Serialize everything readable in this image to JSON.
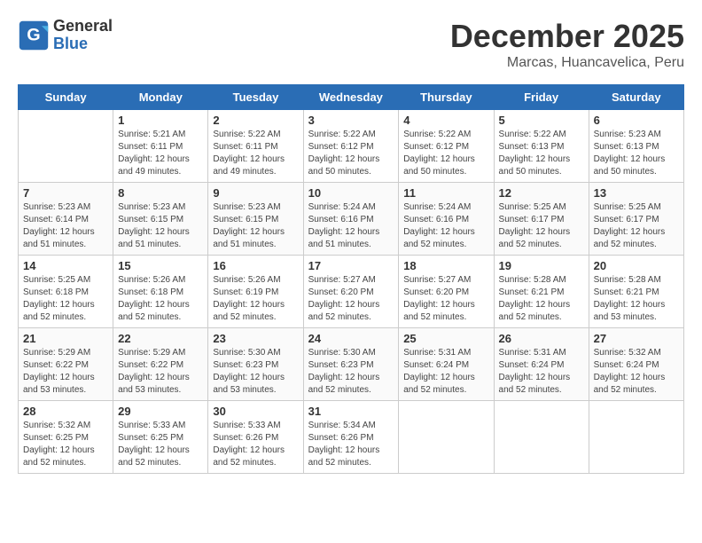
{
  "logo": {
    "general": "General",
    "blue": "Blue"
  },
  "header": {
    "month": "December 2025",
    "location": "Marcas, Huancavelica, Peru"
  },
  "weekdays": [
    "Sunday",
    "Monday",
    "Tuesday",
    "Wednesday",
    "Thursday",
    "Friday",
    "Saturday"
  ],
  "weeks": [
    [
      {
        "day": "",
        "info": ""
      },
      {
        "day": "1",
        "info": "Sunrise: 5:21 AM\nSunset: 6:11 PM\nDaylight: 12 hours\nand 49 minutes."
      },
      {
        "day": "2",
        "info": "Sunrise: 5:22 AM\nSunset: 6:11 PM\nDaylight: 12 hours\nand 49 minutes."
      },
      {
        "day": "3",
        "info": "Sunrise: 5:22 AM\nSunset: 6:12 PM\nDaylight: 12 hours\nand 50 minutes."
      },
      {
        "day": "4",
        "info": "Sunrise: 5:22 AM\nSunset: 6:12 PM\nDaylight: 12 hours\nand 50 minutes."
      },
      {
        "day": "5",
        "info": "Sunrise: 5:22 AM\nSunset: 6:13 PM\nDaylight: 12 hours\nand 50 minutes."
      },
      {
        "day": "6",
        "info": "Sunrise: 5:23 AM\nSunset: 6:13 PM\nDaylight: 12 hours\nand 50 minutes."
      }
    ],
    [
      {
        "day": "7",
        "info": "Sunrise: 5:23 AM\nSunset: 6:14 PM\nDaylight: 12 hours\nand 51 minutes."
      },
      {
        "day": "8",
        "info": "Sunrise: 5:23 AM\nSunset: 6:15 PM\nDaylight: 12 hours\nand 51 minutes."
      },
      {
        "day": "9",
        "info": "Sunrise: 5:23 AM\nSunset: 6:15 PM\nDaylight: 12 hours\nand 51 minutes."
      },
      {
        "day": "10",
        "info": "Sunrise: 5:24 AM\nSunset: 6:16 PM\nDaylight: 12 hours\nand 51 minutes."
      },
      {
        "day": "11",
        "info": "Sunrise: 5:24 AM\nSunset: 6:16 PM\nDaylight: 12 hours\nand 52 minutes."
      },
      {
        "day": "12",
        "info": "Sunrise: 5:25 AM\nSunset: 6:17 PM\nDaylight: 12 hours\nand 52 minutes."
      },
      {
        "day": "13",
        "info": "Sunrise: 5:25 AM\nSunset: 6:17 PM\nDaylight: 12 hours\nand 52 minutes."
      }
    ],
    [
      {
        "day": "14",
        "info": "Sunrise: 5:25 AM\nSunset: 6:18 PM\nDaylight: 12 hours\nand 52 minutes."
      },
      {
        "day": "15",
        "info": "Sunrise: 5:26 AM\nSunset: 6:18 PM\nDaylight: 12 hours\nand 52 minutes."
      },
      {
        "day": "16",
        "info": "Sunrise: 5:26 AM\nSunset: 6:19 PM\nDaylight: 12 hours\nand 52 minutes."
      },
      {
        "day": "17",
        "info": "Sunrise: 5:27 AM\nSunset: 6:20 PM\nDaylight: 12 hours\nand 52 minutes."
      },
      {
        "day": "18",
        "info": "Sunrise: 5:27 AM\nSunset: 6:20 PM\nDaylight: 12 hours\nand 52 minutes."
      },
      {
        "day": "19",
        "info": "Sunrise: 5:28 AM\nSunset: 6:21 PM\nDaylight: 12 hours\nand 52 minutes."
      },
      {
        "day": "20",
        "info": "Sunrise: 5:28 AM\nSunset: 6:21 PM\nDaylight: 12 hours\nand 53 minutes."
      }
    ],
    [
      {
        "day": "21",
        "info": "Sunrise: 5:29 AM\nSunset: 6:22 PM\nDaylight: 12 hours\nand 53 minutes."
      },
      {
        "day": "22",
        "info": "Sunrise: 5:29 AM\nSunset: 6:22 PM\nDaylight: 12 hours\nand 53 minutes."
      },
      {
        "day": "23",
        "info": "Sunrise: 5:30 AM\nSunset: 6:23 PM\nDaylight: 12 hours\nand 53 minutes."
      },
      {
        "day": "24",
        "info": "Sunrise: 5:30 AM\nSunset: 6:23 PM\nDaylight: 12 hours\nand 52 minutes."
      },
      {
        "day": "25",
        "info": "Sunrise: 5:31 AM\nSunset: 6:24 PM\nDaylight: 12 hours\nand 52 minutes."
      },
      {
        "day": "26",
        "info": "Sunrise: 5:31 AM\nSunset: 6:24 PM\nDaylight: 12 hours\nand 52 minutes."
      },
      {
        "day": "27",
        "info": "Sunrise: 5:32 AM\nSunset: 6:24 PM\nDaylight: 12 hours\nand 52 minutes."
      }
    ],
    [
      {
        "day": "28",
        "info": "Sunrise: 5:32 AM\nSunset: 6:25 PM\nDaylight: 12 hours\nand 52 minutes."
      },
      {
        "day": "29",
        "info": "Sunrise: 5:33 AM\nSunset: 6:25 PM\nDaylight: 12 hours\nand 52 minutes."
      },
      {
        "day": "30",
        "info": "Sunrise: 5:33 AM\nSunset: 6:26 PM\nDaylight: 12 hours\nand 52 minutes."
      },
      {
        "day": "31",
        "info": "Sunrise: 5:34 AM\nSunset: 6:26 PM\nDaylight: 12 hours\nand 52 minutes."
      },
      {
        "day": "",
        "info": ""
      },
      {
        "day": "",
        "info": ""
      },
      {
        "day": "",
        "info": ""
      }
    ]
  ]
}
